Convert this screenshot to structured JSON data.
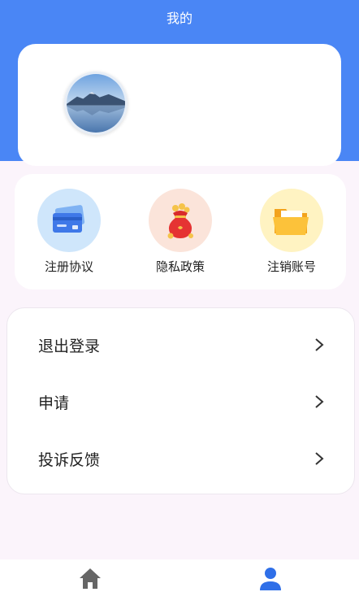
{
  "header": {
    "title": "我的"
  },
  "profile": {
    "avatar_icon": "landscape-avatar-icon"
  },
  "quick_actions": [
    {
      "label": "注册协议",
      "icon": "credit-card-icon",
      "bg": "#cfe6fb"
    },
    {
      "label": "隐私政策",
      "icon": "money-bag-icon",
      "bg": "#fbe4da"
    },
    {
      "label": "注销账号",
      "icon": "folder-icon",
      "bg": "#fff3c2"
    }
  ],
  "menu": [
    {
      "label": "退出登录"
    },
    {
      "label": "申请"
    },
    {
      "label": "投诉反馈"
    }
  ],
  "tabbar": [
    {
      "icon": "home-icon",
      "color": "#666666"
    },
    {
      "icon": "person-icon",
      "color": "#2f6fe8"
    }
  ],
  "colors": {
    "accent": "#4a86f5",
    "background": "#fbf4fb"
  }
}
